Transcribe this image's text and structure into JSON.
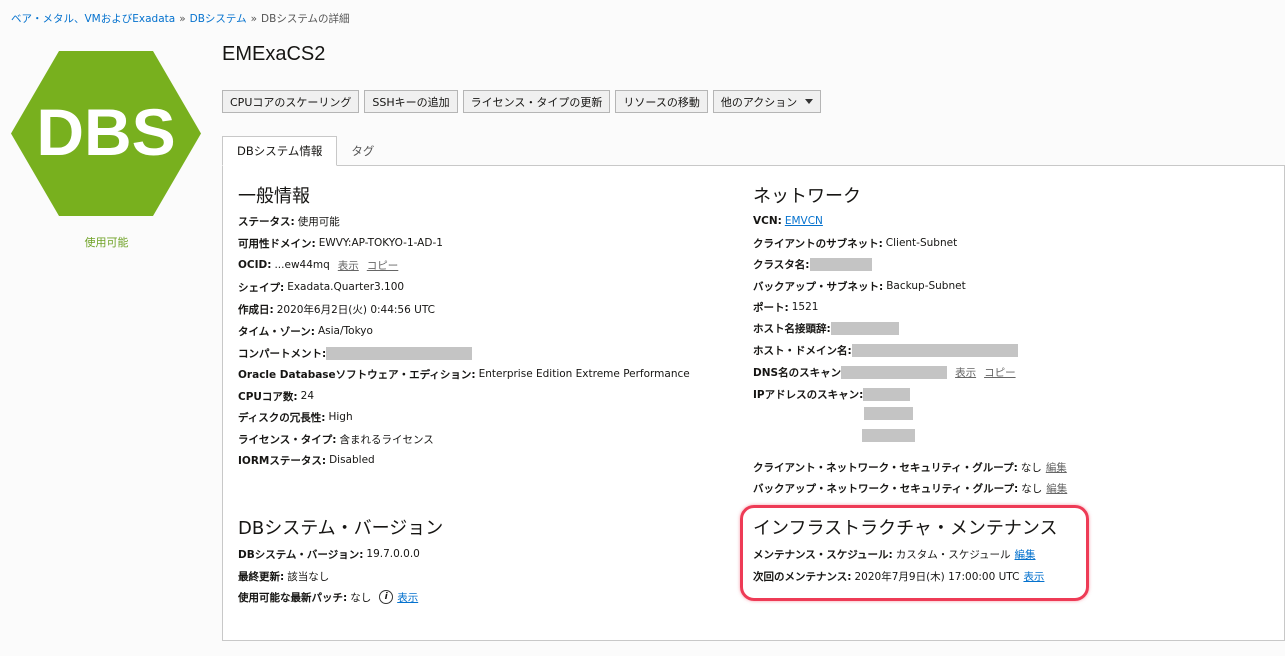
{
  "breadcrumb": {
    "item1": "ベア・メタル、VMおよびExadata",
    "item2": "DBシステム",
    "current": "DBシステムの詳細",
    "separator": "»"
  },
  "logo": {
    "text": "DBS",
    "color": "#78b01e"
  },
  "status": {
    "label": "使用可能",
    "color": "#6fa226"
  },
  "page_title": "EMExaCS2",
  "actions": {
    "cpu_scaling": "CPUコアのスケーリング",
    "add_ssh": "SSHキーの追加",
    "update_license": "ライセンス・タイプの更新",
    "move_resource": "リソースの移動",
    "more_actions": "他のアクション"
  },
  "tabs": {
    "info": "DBシステム情報",
    "tags": "タグ"
  },
  "general": {
    "title": "一般情報",
    "status_label": "ステータス:",
    "status_value": "使用可能",
    "ad_label": "可用性ドメイン:",
    "ad_value": "EWVY:AP-TOKYO-1-AD-1",
    "ocid_label": "OCID:",
    "ocid_value": "...ew44mq",
    "show": "表示",
    "copy": "コピー",
    "shape_label": "シェイプ:",
    "shape_value": "Exadata.Quarter3.100",
    "created_label": "作成日:",
    "created_value": "2020年6月2日(火) 0:44:56 UTC",
    "tz_label": "タイム・ゾーン:",
    "tz_value": "Asia/Tokyo",
    "compartment_label": "コンパートメント:",
    "edition_label": "Oracle Databaseソフトウェア・エディション:",
    "edition_value": "Enterprise Edition Extreme Performance",
    "cpu_label": "CPUコア数:",
    "cpu_value": "24",
    "redundancy_label": "ディスクの冗長性:",
    "redundancy_value": "High",
    "license_label": "ライセンス・タイプ:",
    "license_value": "含まれるライセンス",
    "iorm_label": "IORMステータス:",
    "iorm_value": "Disabled"
  },
  "network": {
    "title": "ネットワーク",
    "vcn_label": "VCN:",
    "vcn_value": "EMVCN",
    "client_subnet_label": "クライアントのサブネット:",
    "client_subnet_value": "Client-Subnet",
    "cluster_label": "クラスタ名:",
    "backup_subnet_label": "バックアップ・サブネット:",
    "backup_subnet_value": "Backup-Subnet",
    "port_label": "ポート:",
    "port_value": "1521",
    "host_prefix_label": "ホスト名接頭辞:",
    "host_domain_label": "ホスト・ドメイン名:",
    "dns_scan_label": "DNS名のスキャン",
    "show": "表示",
    "copy": "コピー",
    "ip_scan_label": "IPアドレスのスキャン:",
    "client_nsg_label": "クライアント・ネットワーク・セキュリティ・グループ:",
    "client_nsg_value": "なし",
    "edit1": "編集",
    "backup_nsg_label": "バックアップ・ネットワーク・セキュリティ・グループ:",
    "backup_nsg_value": "なし",
    "edit2": "編集"
  },
  "version": {
    "title": "DBシステム・バージョン",
    "version_label": "DBシステム・バージョン:",
    "version_value": "19.7.0.0.0",
    "last_update_label": "最終更新:",
    "last_update_value": "該当なし",
    "latest_patch_label": "使用可能な最新パッチ:",
    "latest_patch_value": "なし",
    "show": "表示"
  },
  "maintenance": {
    "title": "インフラストラクチャ・メンテナンス",
    "schedule_label": "メンテナンス・スケジュール:",
    "schedule_value": "カスタム・スケジュール",
    "edit": "編集",
    "next_label": "次回のメンテナンス:",
    "next_value": "2020年7月9日(木) 17:00:00 UTC",
    "show": "表示",
    "highlight_color": "#ee3b56"
  }
}
